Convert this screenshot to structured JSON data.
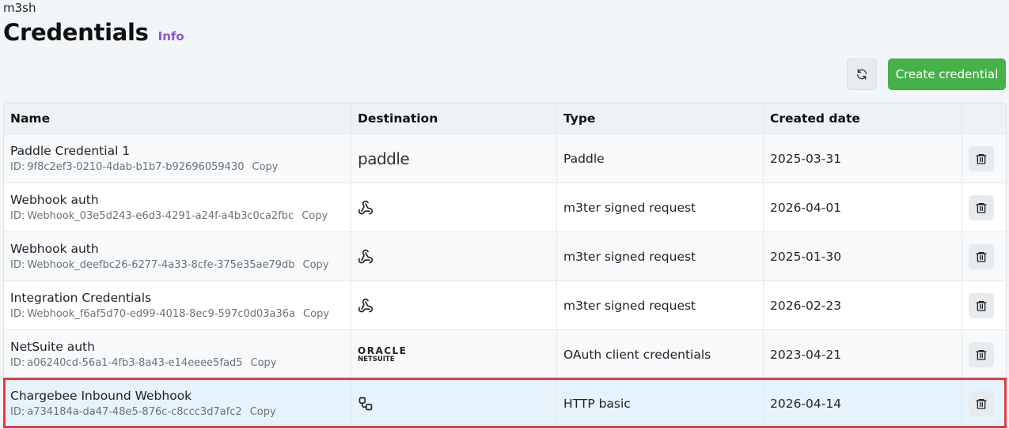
{
  "org": "m3sh",
  "page": {
    "title": "Credentials",
    "info_label": "Info"
  },
  "toolbar": {
    "refresh_icon": "refresh-icon",
    "create_label": "Create credential"
  },
  "table": {
    "columns": [
      "Name",
      "Destination",
      "Type",
      "Created date",
      ""
    ],
    "id_prefix": "ID:",
    "copy_label": "Copy",
    "rows": [
      {
        "name": "Paddle Credential 1",
        "id": "9f8c2ef3-0210-4dab-b1b7-b92696059430",
        "destination": "paddle",
        "destination_logo_text": "paddle",
        "type": "Paddle",
        "created": "2025-03-31"
      },
      {
        "name": "Webhook auth",
        "id": "Webhook_03e5d243-e6d3-4291-a24f-a4b3c0ca2fbc",
        "destination": "webhook-icon",
        "type": "m3ter signed request",
        "created": "2026-04-01"
      },
      {
        "name": "Webhook auth",
        "id": "Webhook_deefbc26-6277-4a33-8cfe-375e35ae79db",
        "destination": "webhook-icon",
        "type": "m3ter signed request",
        "created": "2025-01-30"
      },
      {
        "name": "Integration Credentials",
        "id": "Webhook_f6af5d70-ed99-4018-8ec9-597c0d03a36a",
        "destination": "webhook-icon",
        "type": "m3ter signed request",
        "created": "2026-02-23"
      },
      {
        "name": "NetSuite auth",
        "id": "a06240cd-56a1-4fb3-8a43-e14eeee5fad5",
        "destination": "oracle-netsuite",
        "destination_logo_text": "ORACLE",
        "destination_logo_sub": "NETSUITE",
        "type": "OAuth client credentials",
        "created": "2023-04-21"
      },
      {
        "name": "Chargebee Inbound Webhook",
        "id": "a734184a-da47-48e5-876c-c8ccc3d7afc2",
        "destination": "integration-icon",
        "type": "HTTP basic",
        "created": "2026-04-14",
        "selected": true
      }
    ]
  },
  "colors": {
    "accent_green": "#46b149",
    "info_purple": "#8b55d8",
    "selection_red": "#e53b43",
    "selected_row_bg": "#e6f2fc"
  }
}
